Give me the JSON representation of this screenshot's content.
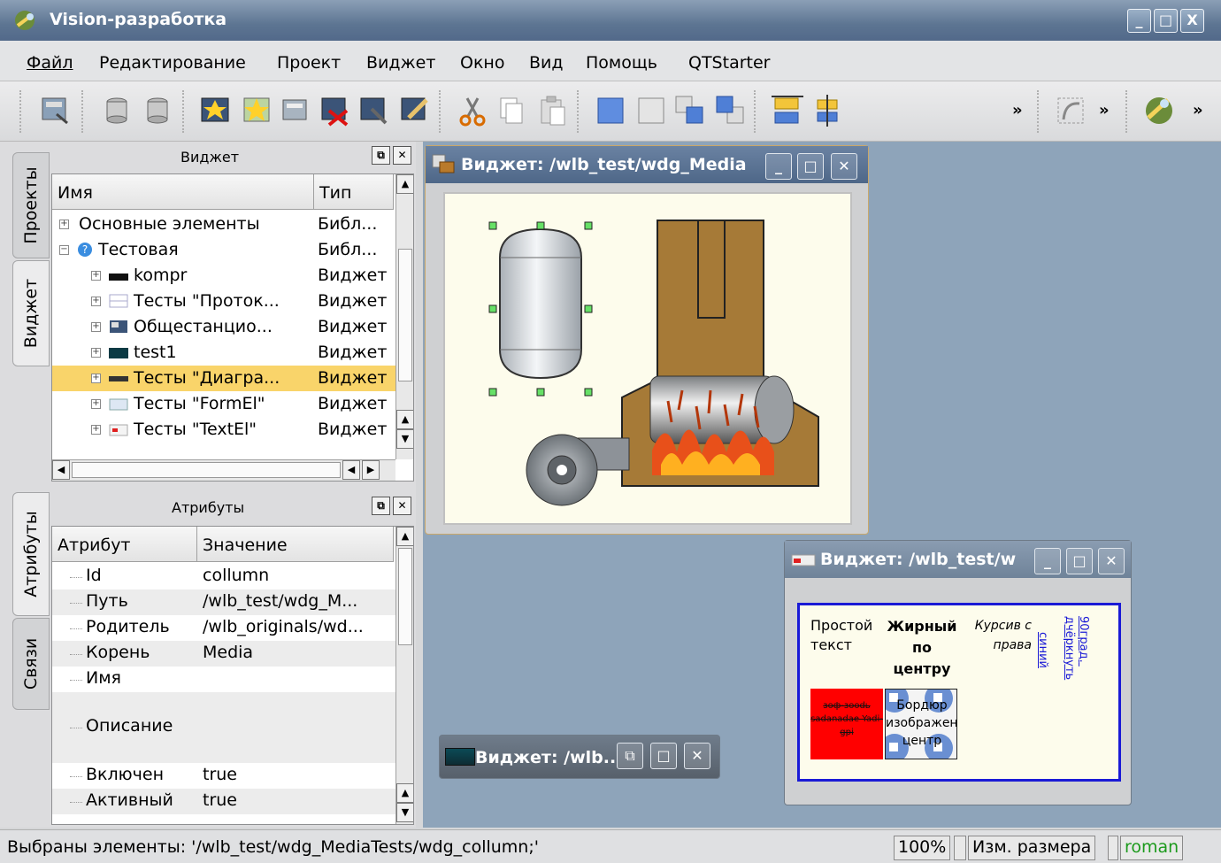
{
  "window": {
    "title": "Vision-разработка",
    "btn_min": "_",
    "btn_max": "□",
    "btn_close": "X"
  },
  "menu": [
    "Файл",
    "Редактирование",
    "Проект",
    "Виджет",
    "Окно",
    "Вид",
    "Помощь",
    "QTStarter"
  ],
  "toolbar": {
    "more1": "»",
    "more2": "»",
    "more3": "»"
  },
  "left_tabs": {
    "projects": "Проекты",
    "widget": "Виджет",
    "attributes": "Атрибуты",
    "links": "Связи"
  },
  "widget_dock": {
    "title": "Виджет",
    "col_name": "Имя",
    "col_type": "Тип",
    "rows": [
      {
        "name": "Основные элементы",
        "type": "Библ...",
        "level": 0,
        "icon": "none"
      },
      {
        "name": "Тестовая",
        "type": "Библ...",
        "level": 0,
        "icon": "question-icon"
      },
      {
        "name": "kompr",
        "type": "Виджет",
        "level": 1,
        "icon": "black"
      },
      {
        "name": "Тесты \"Проток...",
        "type": "Виджет",
        "level": 1,
        "icon": "table"
      },
      {
        "name": "Общестанцио...",
        "type": "Виджет",
        "level": 1,
        "icon": "image"
      },
      {
        "name": "test1",
        "type": "Виджет",
        "level": 1,
        "icon": "dark"
      },
      {
        "name": "Тесты \"Диагра...",
        "type": "Виджет",
        "level": 1,
        "icon": "line",
        "selected": true
      },
      {
        "name": "Тесты \"FormEl\"",
        "type": "Виджет",
        "level": 1,
        "icon": "form"
      },
      {
        "name": "Тесты \"TextEl\"",
        "type": "Виджет",
        "level": 1,
        "icon": "text"
      }
    ]
  },
  "attr_dock": {
    "title": "Атрибуты",
    "col_attr": "Атрибут",
    "col_value": "Значение",
    "rows": [
      {
        "attr": "Id",
        "value": "collumn"
      },
      {
        "attr": "Путь",
        "value": "/wlb_test/wdg_M..."
      },
      {
        "attr": "Родитель",
        "value": "/wlb_originals/wd..."
      },
      {
        "attr": "Корень",
        "value": "Media"
      },
      {
        "attr": "Имя",
        "value": ""
      },
      {
        "attr": "Описание",
        "value": ""
      },
      {
        "attr": "Включен",
        "value": "true"
      },
      {
        "attr": "Активный",
        "value": "true"
      }
    ]
  },
  "sub1": {
    "title": "Виджет: /wlb_test/wdg_Media"
  },
  "sub2": {
    "title": "Виджет: /wlb_test/w",
    "simple_text": "Простой текст",
    "bold_text": "Жирный по центру",
    "italic_text": "Курсив с права",
    "blue_text": "синий",
    "rot_text": "90град. дчёркнуть",
    "red_text": "зоф-зооdь sadanadae Yadi-gpi",
    "border_text": "Бордюр изображени центр"
  },
  "sub3": {
    "title": "Виджет: /wlb.."
  },
  "status": {
    "text": "Выбраны элементы: '/wlb_test/wdg_MediaTests/wdg_collumn;'",
    "zoom": "100%",
    "mode": "Изм. размера",
    "user": "roman"
  }
}
